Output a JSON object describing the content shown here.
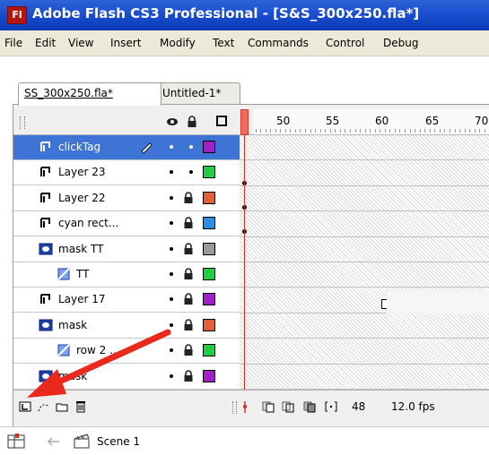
{
  "window": {
    "app_icon_text": "Fl",
    "title": "Adobe Flash CS3 Professional - [S&S_300x250.fla*]"
  },
  "menu": [
    "File",
    "Edit",
    "View",
    "Insert",
    "Modify",
    "Text",
    "Commands",
    "Control",
    "Debug"
  ],
  "tabs": [
    {
      "label": "SS_300x250.fla*",
      "active": true
    },
    {
      "label": "Untitled-1*",
      "active": false
    }
  ],
  "timeline": {
    "ruler_numbers": [
      "50",
      "55",
      "60",
      "65",
      "70"
    ],
    "layers": [
      {
        "name": "clickTag",
        "type": "normal",
        "selected": true,
        "pencil": true,
        "locked": false,
        "color": "#a020c8"
      },
      {
        "name": "Layer 23",
        "type": "normal",
        "selected": false,
        "pencil": false,
        "locked": false,
        "color": "#22cc44"
      },
      {
        "name": "Layer 22",
        "type": "normal",
        "selected": false,
        "pencil": false,
        "locked": true,
        "color": "#e0603a"
      },
      {
        "name": "cyan rect...",
        "type": "normal",
        "selected": false,
        "pencil": false,
        "locked": true,
        "color": "#2a8fe0"
      },
      {
        "name": "mask TT",
        "type": "mask",
        "selected": false,
        "pencil": false,
        "locked": true,
        "color": "#9a9a9a"
      },
      {
        "name": "TT",
        "type": "masked",
        "selected": false,
        "pencil": false,
        "locked": true,
        "color": "#22cc44"
      },
      {
        "name": "Layer 17",
        "type": "normal",
        "selected": false,
        "pencil": false,
        "locked": true,
        "color": "#a020c8"
      },
      {
        "name": "mask",
        "type": "mask",
        "selected": false,
        "pencil": false,
        "locked": true,
        "color": "#e0603a"
      },
      {
        "name": "row 2 ...",
        "type": "masked",
        "selected": false,
        "pencil": false,
        "locked": true,
        "color": "#22cc44"
      },
      {
        "name": "mask",
        "type": "mask",
        "selected": false,
        "pencil": false,
        "locked": true,
        "color": "#a020c8"
      }
    ],
    "current_frame": "48",
    "fps": "12.0 fps"
  },
  "scene": {
    "label": "Scene 1"
  },
  "colors": {
    "accent": "#3d74d6",
    "playhead": "#f06b5e",
    "annotation_arrow": "#e8291c"
  }
}
